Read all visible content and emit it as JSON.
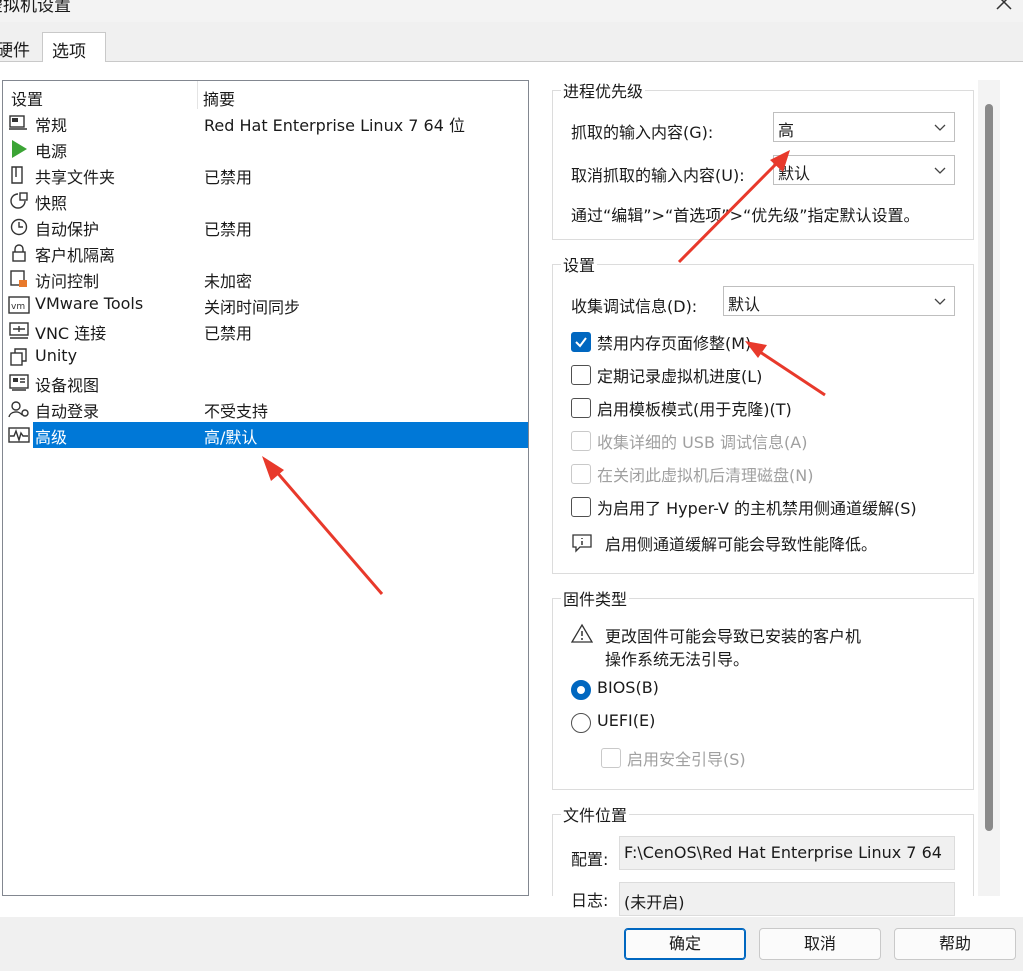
{
  "window": {
    "title": "虚拟机设置",
    "close_icon": "close-icon"
  },
  "tabs": [
    {
      "label": "硬件",
      "active": false
    },
    {
      "label": "选项",
      "active": true
    }
  ],
  "settings_list": {
    "columns": [
      "设置",
      "摘要"
    ],
    "items": [
      {
        "label": "常规",
        "summary": "Red Hat Enterprise Linux 7 64 位",
        "icon": "general-icon"
      },
      {
        "label": "电源",
        "summary": "",
        "icon": "power-play-icon"
      },
      {
        "label": "共享文件夹",
        "summary": "已禁用",
        "icon": "shared-folder-icon"
      },
      {
        "label": "快照",
        "summary": "",
        "icon": "snapshot-icon"
      },
      {
        "label": "自动保护",
        "summary": "已禁用",
        "icon": "autoprotect-clock-icon"
      },
      {
        "label": "客户机隔离",
        "summary": "",
        "icon": "lock-icon"
      },
      {
        "label": "访问控制",
        "summary": "未加密",
        "icon": "access-control-icon"
      },
      {
        "label": "VMware Tools",
        "summary": "关闭时间同步",
        "icon": "vmware-tools-icon"
      },
      {
        "label": "VNC 连接",
        "summary": "已禁用",
        "icon": "vnc-icon"
      },
      {
        "label": "Unity",
        "summary": "",
        "icon": "unity-icon"
      },
      {
        "label": "设备视图",
        "summary": "",
        "icon": "device-view-icon"
      },
      {
        "label": "自动登录",
        "summary": "不受支持",
        "icon": "autologin-icon"
      },
      {
        "label": "高级",
        "summary": "高/默认",
        "icon": "advanced-icon",
        "selected": true
      }
    ]
  },
  "process_priority": {
    "title": "进程优先级",
    "grabbed_label": "抓取的输入内容(G):",
    "grabbed_value": "高",
    "ungrabbed_label": "取消抓取的输入内容(U):",
    "ungrabbed_value": "默认",
    "hint": "通过“编辑”>“首选项”>“优先级”指定默认设置。"
  },
  "settings_group": {
    "title": "设置",
    "debug_label": "收集调试信息(D):",
    "debug_value": "默认",
    "options": [
      {
        "label": "禁用内存页面修整(M)",
        "checked": true,
        "enabled": true
      },
      {
        "label": "定期记录虚拟机进度(L)",
        "checked": false,
        "enabled": true
      },
      {
        "label": "启用模板模式(用于克隆)(T)",
        "checked": false,
        "enabled": true
      },
      {
        "label": "收集详细的 USB 调试信息(A)",
        "checked": false,
        "enabled": false
      },
      {
        "label": "在关闭此虚拟机后清理磁盘(N)",
        "checked": false,
        "enabled": false
      },
      {
        "label": "为启用了 Hyper-V 的主机禁用侧通道缓解(S)",
        "checked": false,
        "enabled": true
      }
    ],
    "info_text": "启用侧通道缓解可能会导致性能降低。"
  },
  "firmware": {
    "title": "固件类型",
    "warning_line1": "更改固件可能会导致已安装的客户机",
    "warning_line2": "操作系统无法引导。",
    "bios_label": "BIOS(B)",
    "uefi_label": "UEFI(E)",
    "secure_boot_label": "启用安全引导(S)",
    "selected": "BIOS"
  },
  "file_location": {
    "title": "文件位置",
    "config_label": "配置:",
    "config_value": "F:\\CenOS\\Red Hat Enterprise Linux 7 64",
    "log_label": "日志:",
    "log_value": "(未开启)"
  },
  "buttons": {
    "ok": "确定",
    "cancel": "取消",
    "help": "帮助"
  },
  "colors": {
    "accent": "#0078d7",
    "annotation": "#e8392b"
  }
}
